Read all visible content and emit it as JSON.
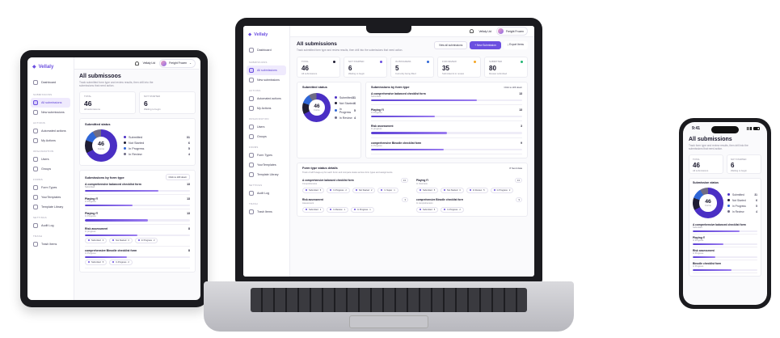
{
  "brand": {
    "name": "Vellaly"
  },
  "colors": {
    "accent": "#6b4fe0",
    "submitted": "#4a2fc4",
    "not_started": "#1f1d33",
    "in_progress": "#2f66d6",
    "in_review": "#6f6c85",
    "stat_green": "#22b573",
    "stat_orange": "#f5a524",
    "stat_purple": "#6b4fe0"
  },
  "sidebar": {
    "top_item": "Dashboard",
    "sections": [
      {
        "label": "Submissions",
        "items": [
          {
            "label": "All submissions",
            "active": true
          },
          {
            "label": "New submissions",
            "active": false
          }
        ]
      },
      {
        "label": "Actions",
        "items": [
          {
            "label": "Automated actions",
            "active": false
          },
          {
            "label": "My Actions",
            "active": false
          }
        ]
      },
      {
        "label": "Organization",
        "items": [
          {
            "label": "Users",
            "active": false
          },
          {
            "label": "Groups",
            "active": false
          }
        ]
      },
      {
        "label": "Forms",
        "items": [
          {
            "label": "Form Types",
            "active": false
          },
          {
            "label": "YourTemplates",
            "active": false
          },
          {
            "label": "Template Library",
            "active": false
          }
        ]
      },
      {
        "label": "Settings",
        "items": [
          {
            "label": "Audit Log",
            "active": false
          }
        ]
      },
      {
        "label": "Trash",
        "items": [
          {
            "label": "Trash Items",
            "active": false
          }
        ]
      }
    ]
  },
  "topbar": {
    "user_short": "Vellaly Ltd",
    "user_name": "Freight Frozen"
  },
  "header": {
    "title": "All submissions",
    "tablet_title": "All submissoos",
    "subtitle": "Track submitted form type and review results, then drill into the submissions that need action.",
    "view_all": "View all submissions",
    "new_submission": "New Submission",
    "export": "Export Items"
  },
  "stats": [
    {
      "label": "Total",
      "value": "46",
      "sub": "All submissions",
      "dot": "#1f1d33"
    },
    {
      "label": "Not started",
      "value": "6",
      "sub": "Waiting to begin",
      "dot": "#6b4fe0"
    },
    {
      "label": "In progress",
      "value": "5",
      "sub": "Currently being filled",
      "dot": "#2f66d6"
    },
    {
      "label": "For review",
      "value": "35",
      "sub": "Submitted & in review",
      "dot": "#f5a524"
    },
    {
      "label": "Submitted",
      "value": "80",
      "sub": "Review submitted",
      "dot": "#22b573"
    }
  ],
  "status_card": {
    "title": "Submitted status",
    "total": "46",
    "caption": "Forms",
    "legend": [
      {
        "label": "Submitted",
        "value": "31",
        "share": 0.674
      },
      {
        "label": "Not Started",
        "value": "6",
        "share": 0.13
      },
      {
        "label": "In Progress",
        "value": "5",
        "share": 0.109
      },
      {
        "label": "In Review",
        "value": "4",
        "share": 0.087
      }
    ]
  },
  "by_form": {
    "title": "Submissions by form type",
    "link": "Click to drill down",
    "rows": [
      {
        "name": "A comprehensive balanced checklist form",
        "meta": "Submitted",
        "count": "13",
        "progress": 0.7
      },
      {
        "name": "Playing f'l",
        "meta": "In Progress",
        "count": "13",
        "progress": 0.42
      },
      {
        "name": "Risk assessment",
        "meta": "In progress",
        "count": "3",
        "progress": 0.5
      },
      {
        "name": "comprehensive Binodle checklist form",
        "meta": "In Progress",
        "count": "9",
        "progress": 0.48
      }
    ]
  },
  "tablet_form": {
    "title": "Submissions by form type",
    "link": "Click to drill down",
    "rows": [
      {
        "name": "A comprehensive balanced checklist form",
        "meta": "Submitted",
        "count": "13",
        "progress": 0.7
      },
      {
        "name": "Playing f'l",
        "meta": "In Progress",
        "count": "13",
        "progress": 0.45
      },
      {
        "name": "Playing f'l",
        "meta": "In Progress",
        "count": "13",
        "progress": 0.6
      },
      {
        "name": "Risk assessment",
        "meta": "In progress",
        "count": "8",
        "progress": 0.5,
        "chips": [
          {
            "label": "Submitted",
            "value": "3"
          },
          {
            "label": "Not Started",
            "value": "3"
          },
          {
            "label": "In Progress",
            "value": "2"
          }
        ]
      },
      {
        "name": "comprehensive Binodle checklist form",
        "meta": "In Progress",
        "count": "8",
        "progress": 0.4,
        "chips": [
          {
            "label": "Submitted",
            "value": "5"
          },
          {
            "label": "In Progress",
            "value": "2"
          }
        ]
      }
    ]
  },
  "detail": {
    "title": "Form type status details",
    "subtitle": "Track of all 8 stage-up for each Form and compare status across form types and assignments.",
    "link": "8 Send data",
    "items": [
      {
        "name": "A comprehensive balanced checklist form",
        "meta": "Comprehensive",
        "count": "13",
        "chips": [
          {
            "label": "Submitted",
            "value": "5"
          },
          {
            "label": "In Progress",
            "value": "2"
          },
          {
            "label": "Not Started",
            "value": "2"
          },
          {
            "label": "In Super",
            "value": "1"
          }
        ]
      },
      {
        "name": "Playing f'l",
        "meta": "In Overview",
        "count": "13",
        "chips": [
          {
            "label": "Submitted",
            "value": "5"
          },
          {
            "label": "Not Started",
            "value": "3"
          },
          {
            "label": "In Review",
            "value": "5"
          },
          {
            "label": "In Progress",
            "value": "2"
          }
        ]
      },
      {
        "name": "Risk assessment",
        "meta": "Assessment",
        "count": "3",
        "chips": [
          {
            "label": "Submitted",
            "value": "1"
          },
          {
            "label": "In Review",
            "value": "1"
          },
          {
            "label": "In Progress",
            "value": "1"
          }
        ]
      },
      {
        "name": "comprehensive Binodle checklist form",
        "meta": "In comprehension",
        "count": "9",
        "chips": [
          {
            "label": "Submitted",
            "value": "5"
          },
          {
            "label": "In Progress",
            "value": "2"
          }
        ]
      }
    ]
  },
  "phone": {
    "time": "9:41",
    "title": "All submissions",
    "subtitle": "Track form type and review results, then drill into the submissions that need action.",
    "card_title": "Submission status",
    "rows": [
      {
        "name": "A comprehensive balanced checklist form",
        "meta": "Submitted",
        "progress": 0.72
      },
      {
        "name": "Playing f'l",
        "meta": "In Progress",
        "progress": 0.48
      },
      {
        "name": "Risk assessment",
        "meta": "In Progress",
        "progress": 0.35
      },
      {
        "name": "Binodle checklist form",
        "meta": "In Progress",
        "progress": 0.6
      }
    ]
  }
}
